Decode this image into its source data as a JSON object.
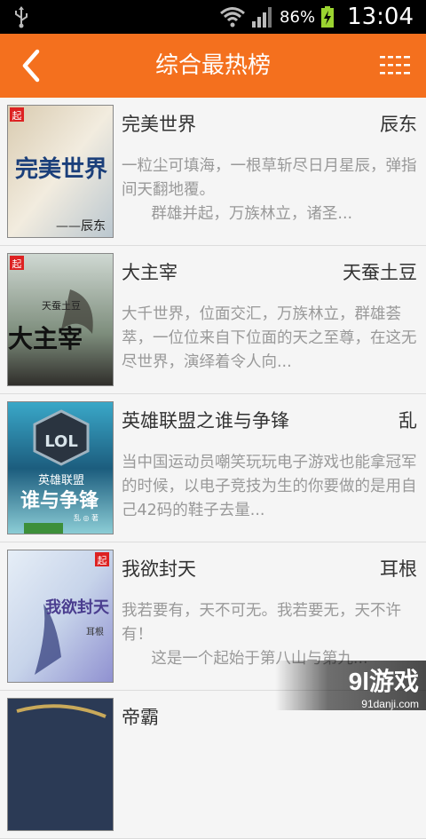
{
  "status": {
    "battery": "86%",
    "time": "13:04"
  },
  "header": {
    "title": "综合最热榜"
  },
  "books": [
    {
      "title": "完美世界",
      "author": "辰东",
      "desc": "一粒尘可填海，一根草斩尽日月星辰，弹指间天翻地覆。\n      群雄并起，万族林立，诸圣...",
      "cover_title": "完美世界",
      "cover_sub": "——辰东",
      "cover_logo": "起"
    },
    {
      "title": "大主宰",
      "author": "天蚕土豆",
      "desc": "大千世界，位面交汇，万族林立，群雄荟萃，一位位来自下位面的天之至尊，在这无尽世界，演绎着令人向...",
      "cover_title": "大主宰",
      "cover_sub": "天蚕土豆",
      "cover_logo": "起"
    },
    {
      "title": "英雄联盟之谁与争锋",
      "author": "乱",
      "desc": "当中国运动员嘲笑玩玩电子游戏也能拿冠军的时候，以电子竞技为生的你要做的是用自己42码的鞋子去量...",
      "cover_title": "谁与争锋",
      "cover_sub": "英雄联盟",
      "cover_logo": "乱 ◎ 著"
    },
    {
      "title": "我欲封天",
      "author": "耳根",
      "desc": "我若要有，天不可无。我若要无，天不许有！\n      这是一个起始于第八山与第九...",
      "cover_title": "我欲封天",
      "cover_sub": "耳根",
      "cover_logo": "起"
    },
    {
      "title": "帝霸",
      "author": "",
      "desc": "",
      "cover_title": "",
      "cover_sub": "",
      "cover_logo": ""
    }
  ],
  "watermark": {
    "text": "9l游戏",
    "sub": "91danji.com"
  },
  "colors": {
    "accent": "#f4701e",
    "text": "#333333",
    "muted": "#999999"
  }
}
